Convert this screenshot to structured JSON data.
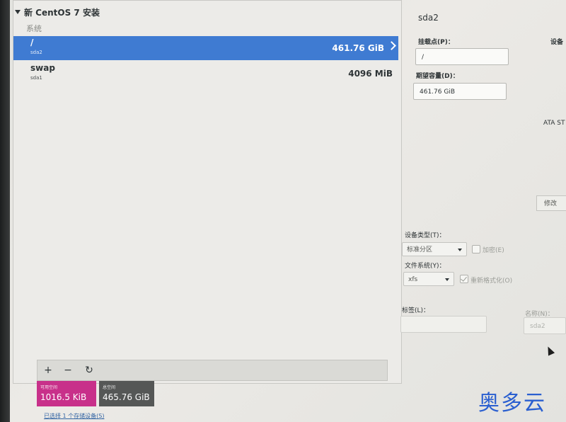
{
  "left": {
    "header": "新 CentOS 7 安装",
    "group": "系统",
    "partitions": [
      {
        "mount": "/",
        "device": "sda2",
        "size": "461.76 GiB",
        "selected": true
      },
      {
        "mount": "swap",
        "device": "sda1",
        "size": "4096 MiB",
        "selected": false
      }
    ],
    "toolbar": {
      "add": "+",
      "remove": "−",
      "refresh": "↻"
    },
    "available_space": {
      "label": "可用空间",
      "value": "1016.5 KiB"
    },
    "total_space": {
      "label": "总空间",
      "value": "465.76 GiB"
    },
    "selected_devices_link": "已选择 1 个存储设备(S)"
  },
  "right": {
    "partition_title": "sda2",
    "mount_point_label": "挂载点(P)：",
    "mount_point_value": "/",
    "desired_capacity_label": "期望容量(D)：",
    "desired_capacity_value": "461.76 GiB",
    "device_label": "设备",
    "ata_text": "ATA ST",
    "modify_button": "修改",
    "device_type_label": "设备类型(T)：",
    "device_type_value": "标准分区",
    "encrypt_label": "加密(E)",
    "encrypt_checked": false,
    "filesystem_label": "文件系统(Y)：",
    "filesystem_value": "xfs",
    "reformat_label": "重新格式化(O)",
    "reformat_checked": true,
    "label_label": "标签(L)：",
    "label_value": "",
    "name_label": "名称(N)：",
    "name_value": "sda2"
  },
  "watermark": "奥多云",
  "colors": {
    "selection": "#3f7bd2",
    "available": "#c8308a",
    "total": "#555756",
    "watermark": "#2a5fd0"
  }
}
